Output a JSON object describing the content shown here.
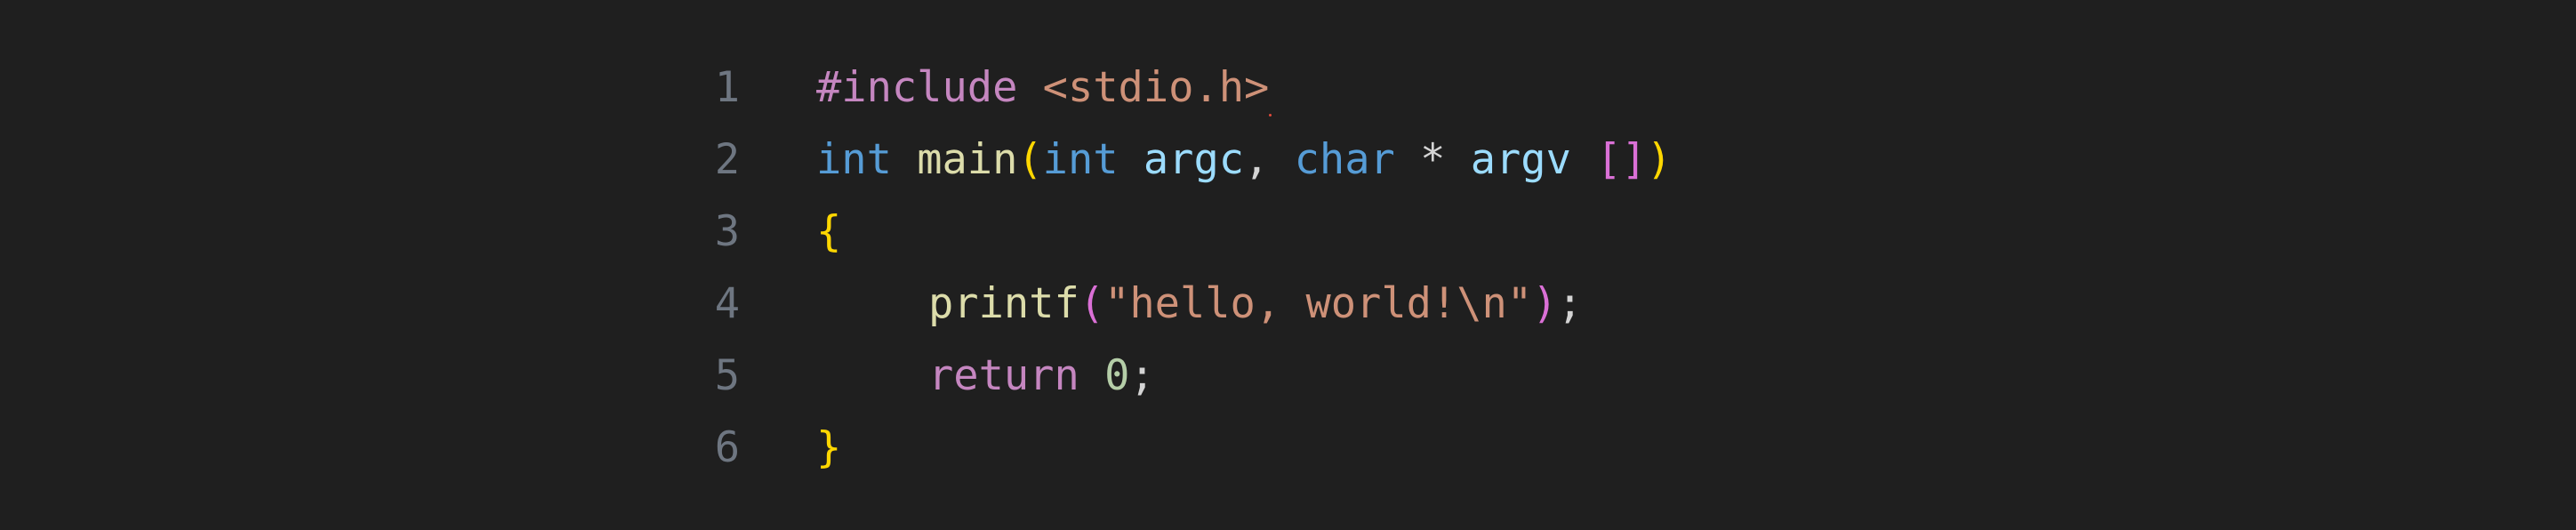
{
  "editor": {
    "lines": [
      {
        "number": "1",
        "tokens": {
          "t1": "#include",
          "t2": " ",
          "t3": "<stdio.h>"
        }
      },
      {
        "number": "2",
        "tokens": {
          "t1": "int",
          "t2": " ",
          "t3": "main",
          "t4": "(",
          "t5": "int",
          "t6": " ",
          "t7": "argc",
          "t8": ", ",
          "t9": "char",
          "t10": " * ",
          "t11": "argv",
          "t12": " ",
          "t13": "[]",
          "t14": ")"
        }
      },
      {
        "number": "3",
        "tokens": {
          "t1": "{"
        }
      },
      {
        "number": "4",
        "tokens": {
          "t1": "printf",
          "t2": "(",
          "t3": "\"hello, world!\\n\"",
          "t4": ")",
          "t5": ";"
        }
      },
      {
        "number": "5",
        "tokens": {
          "t1": "return",
          "t2": " ",
          "t3": "0",
          "t4": ";"
        }
      },
      {
        "number": "6",
        "tokens": {
          "t1": "}"
        }
      }
    ],
    "colors": {
      "background": "#1f1f1f",
      "line_number": "#6e7681",
      "preprocessor": "#c586c0",
      "string": "#ce9178",
      "type": "#569cd6",
      "function": "#dcdcaa",
      "variable": "#9cdcfe",
      "bracket_level1": "#ffd700",
      "bracket_level2": "#da70d6",
      "number": "#b5cea8",
      "diagnostic_error": "#e04a3a"
    }
  }
}
